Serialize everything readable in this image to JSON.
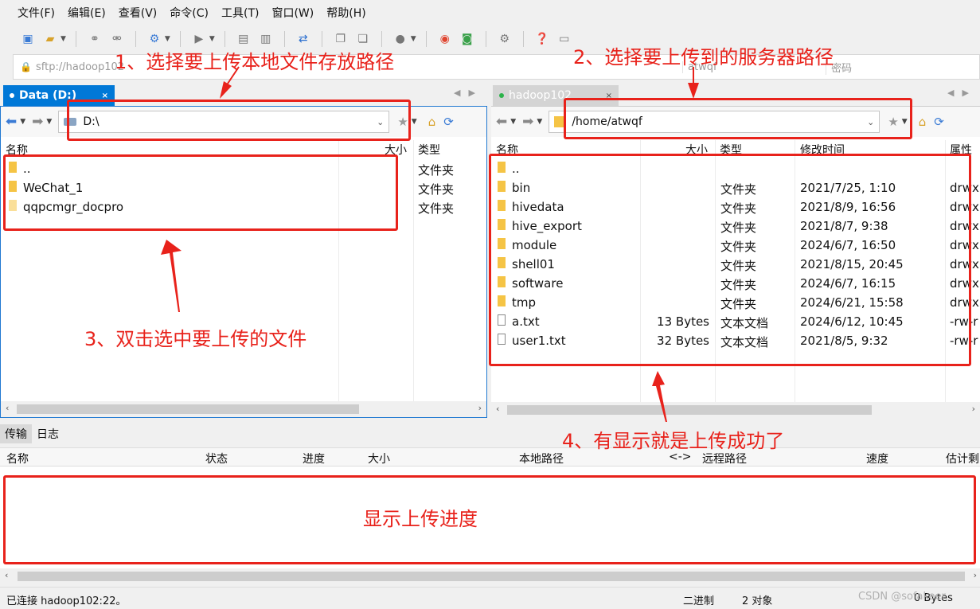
{
  "menu": [
    "文件(F)",
    "编辑(E)",
    "查看(V)",
    "命令(C)",
    "工具(T)",
    "窗口(W)",
    "帮助(H)"
  ],
  "address": {
    "host": "sftp://hadoop102",
    "user": "atwqf",
    "password_placeholder": "密码"
  },
  "left_tab": {
    "label": "Data (D:)"
  },
  "right_tab": {
    "label": "hadoop102"
  },
  "left_panel": {
    "path": "D:\\",
    "columns": {
      "name": "名称",
      "size": "大小",
      "type": "类型"
    },
    "rows": [
      {
        "name": "..",
        "type": "文件夹"
      },
      {
        "name": "WeChat_1",
        "type": "文件夹"
      },
      {
        "name": "qqpcmgr_docpro",
        "type": "文件夹"
      }
    ]
  },
  "right_panel": {
    "path": "/home/atwqf",
    "columns": {
      "name": "名称",
      "size": "大小",
      "type": "类型",
      "modified": "修改时间",
      "attr": "属性"
    },
    "rows": [
      {
        "name": "..",
        "size": "",
        "type": "",
        "modified": "",
        "attr": "",
        "kind": "folder"
      },
      {
        "name": "bin",
        "size": "",
        "type": "文件夹",
        "modified": "2021/7/25, 1:10",
        "attr": "drwxr",
        "kind": "folder"
      },
      {
        "name": "hivedata",
        "size": "",
        "type": "文件夹",
        "modified": "2021/8/9, 16:56",
        "attr": "drwxr",
        "kind": "folder"
      },
      {
        "name": "hive_export",
        "size": "",
        "type": "文件夹",
        "modified": "2021/8/7, 9:38",
        "attr": "drwxr",
        "kind": "folder"
      },
      {
        "name": "module",
        "size": "",
        "type": "文件夹",
        "modified": "2024/6/7, 16:50",
        "attr": "drwxr",
        "kind": "folder"
      },
      {
        "name": "shell01",
        "size": "",
        "type": "文件夹",
        "modified": "2021/8/15, 20:45",
        "attr": "drwxr",
        "kind": "folder"
      },
      {
        "name": "software",
        "size": "",
        "type": "文件夹",
        "modified": "2024/6/7, 16:15",
        "attr": "drwxr",
        "kind": "folder"
      },
      {
        "name": "tmp",
        "size": "",
        "type": "文件夹",
        "modified": "2024/6/21, 15:58",
        "attr": "drwxr",
        "kind": "folder"
      },
      {
        "name": "a.txt",
        "size": "13 Bytes",
        "type": "文本文档",
        "modified": "2024/6/12, 10:45",
        "attr": "-rw-r",
        "kind": "file"
      },
      {
        "name": "user1.txt",
        "size": "32 Bytes",
        "type": "文本文档",
        "modified": "2021/8/5, 9:32",
        "attr": "-rw-r",
        "kind": "file"
      }
    ]
  },
  "transfer": {
    "tabs": [
      "传输",
      "日志"
    ],
    "columns": [
      "名称",
      "状态",
      "进度",
      "大小",
      "本地路径",
      "<->",
      "远程路径",
      "速度",
      "估计剩"
    ]
  },
  "status": {
    "connection": "已连接 hadoop102:22。",
    "mode": "二进制",
    "objects": "2 对象",
    "bytes": "0 Bytes"
  },
  "annotations": {
    "note1": "1、选择要上传本地文件存放路径",
    "note2": "2、选择要上传到的服务器路径",
    "note3": "3、双击选中要上传的文件",
    "note4": "4、有显示就是上传成功了",
    "note5": "显示上传进度"
  },
  "watermark": "CSDN @sofakeer",
  "colors": {
    "annotation_red": "#e8221b",
    "active_tab_blue": "#0078d7",
    "folder_yellow": "#f5c445"
  }
}
